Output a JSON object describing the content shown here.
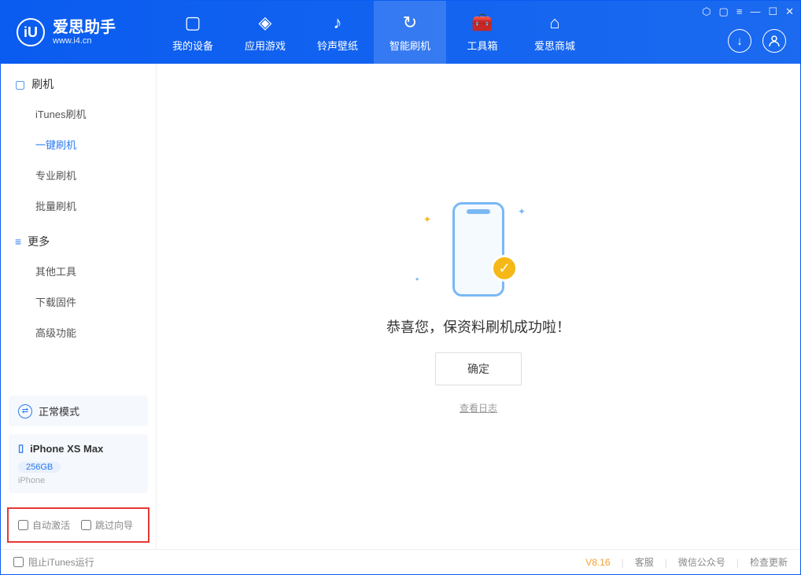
{
  "app": {
    "title": "爱思助手",
    "subtitle": "www.i4.cn"
  },
  "tabs": [
    {
      "label": "我的设备",
      "icon": "▢"
    },
    {
      "label": "应用游戏",
      "icon": "◈"
    },
    {
      "label": "铃声壁纸",
      "icon": "♪"
    },
    {
      "label": "智能刷机",
      "icon": "↻",
      "active": true
    },
    {
      "label": "工具箱",
      "icon": "🧰"
    },
    {
      "label": "爱思商城",
      "icon": "⌂"
    }
  ],
  "winctrl": {
    "hex": "⬡",
    "square": "▢",
    "list": "≡",
    "min": "—",
    "max": "☐",
    "close": "✕"
  },
  "headerbtns": {
    "download": "↓",
    "user": "○"
  },
  "sidebar": {
    "sections": [
      {
        "icon": "▢",
        "title": "刷机",
        "items": [
          "iTunes刷机",
          "一键刷机",
          "专业刷机",
          "批量刷机"
        ],
        "activeIndex": 1
      },
      {
        "icon": "≡",
        "title": "更多",
        "items": [
          "其他工具",
          "下载固件",
          "高级功能"
        ]
      }
    ]
  },
  "device": {
    "mode": "正常模式",
    "name": "iPhone XS Max",
    "storage": "256GB",
    "type": "iPhone"
  },
  "checks": {
    "auto": "自动激活",
    "skip": "跳过向导"
  },
  "main": {
    "message": "恭喜您，保资料刷机成功啦！",
    "ok": "确定",
    "log": "查看日志"
  },
  "status": {
    "block": "阻止iTunes运行",
    "version": "V8.16",
    "links": [
      "客服",
      "微信公众号",
      "检查更新"
    ]
  }
}
